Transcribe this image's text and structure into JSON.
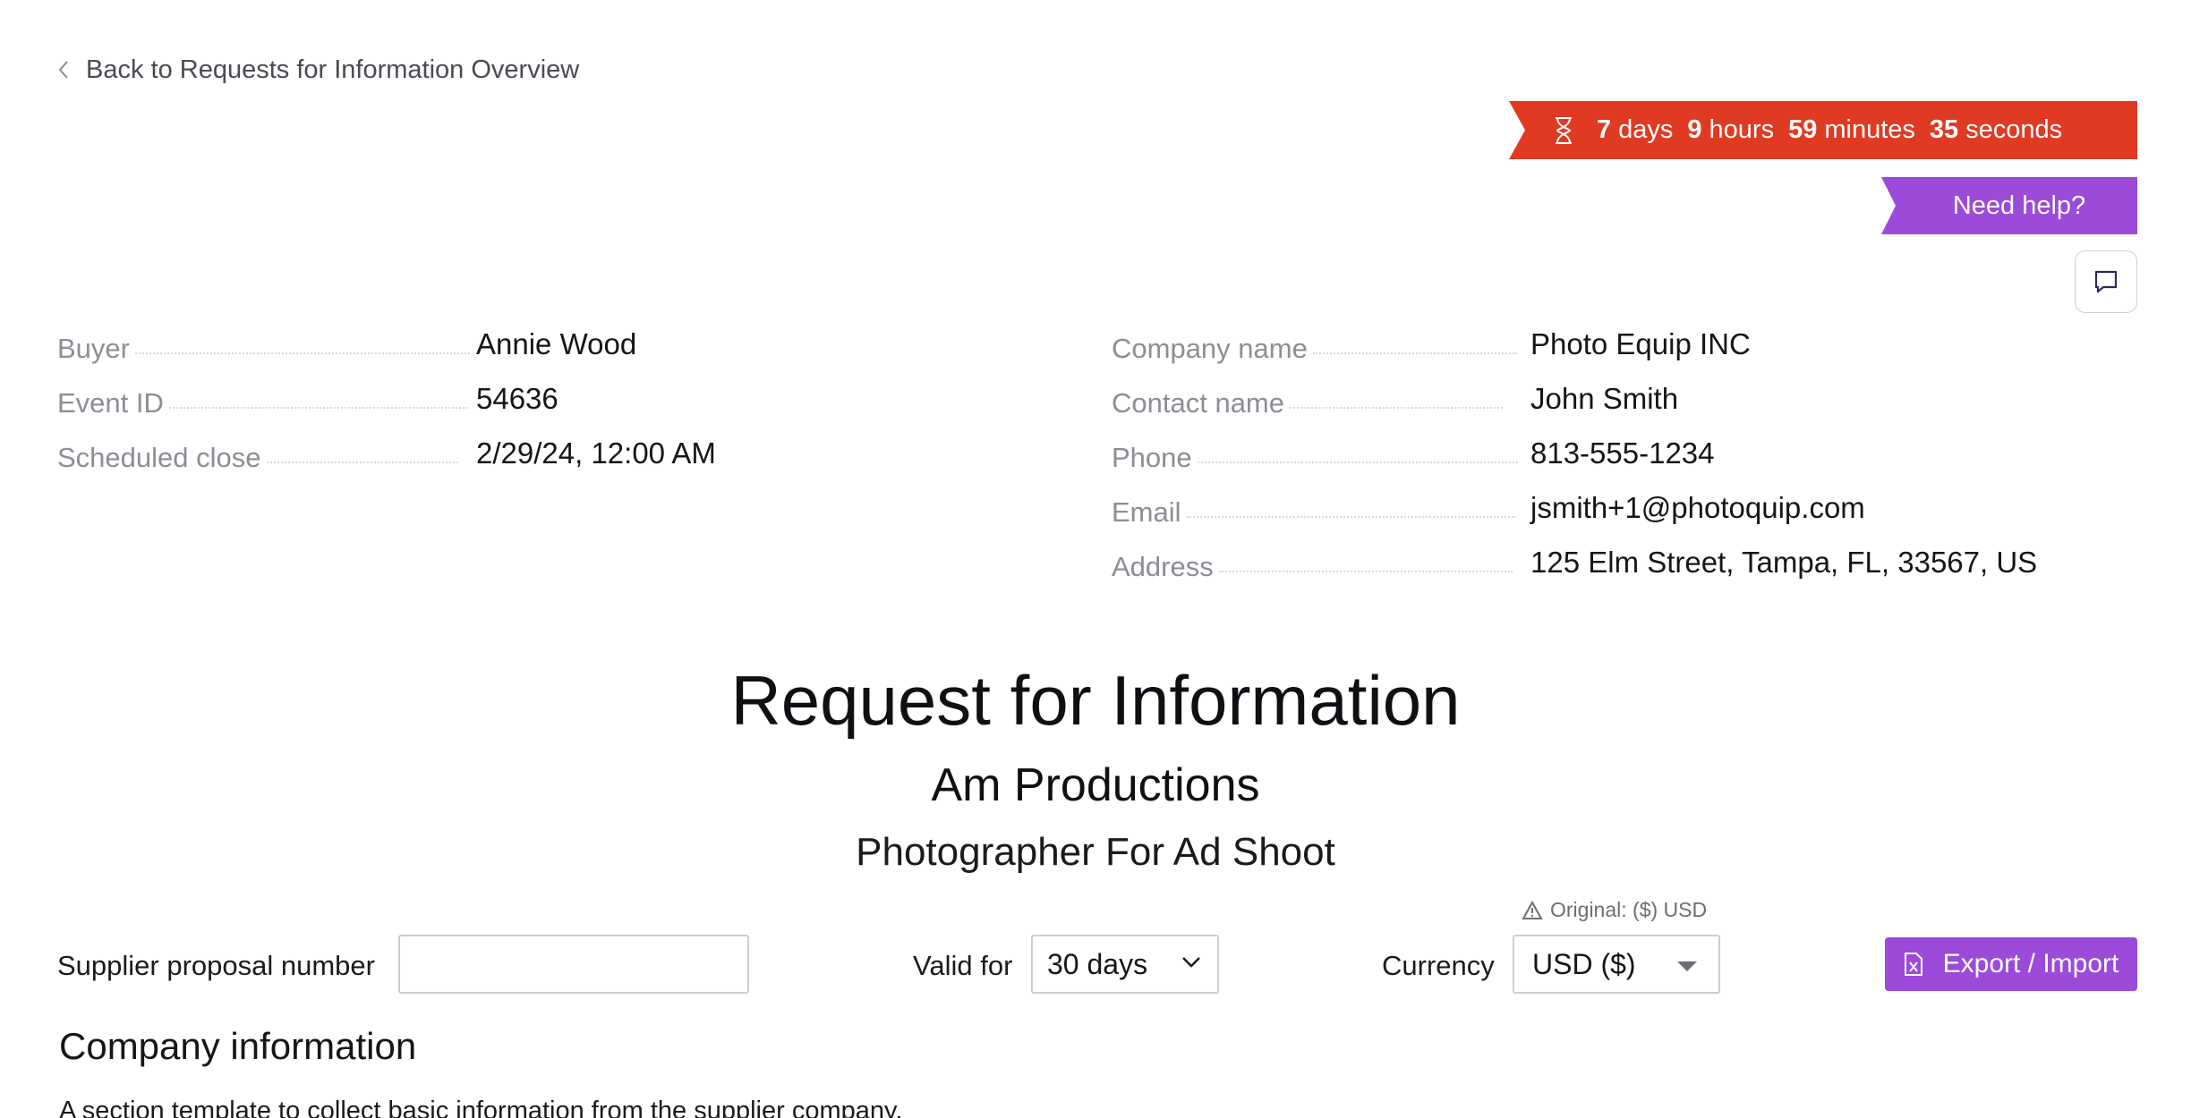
{
  "nav": {
    "back_label": "Back to Requests for Information Overview"
  },
  "timer": {
    "days": "7",
    "days_unit": "days",
    "hours": "9",
    "hours_unit": "hours",
    "minutes": "59",
    "minutes_unit": "minutes",
    "seconds": "35",
    "seconds_unit": "seconds",
    "color": "#e03a22"
  },
  "help": {
    "label": "Need help?",
    "color": "#9b4ad9"
  },
  "buyer_info": [
    {
      "label": "Buyer",
      "value": "Annie Wood"
    },
    {
      "label": "Event ID",
      "value": "54636"
    },
    {
      "label": "Scheduled close",
      "value": "2/29/24, 12:00 AM"
    }
  ],
  "supplier_info": [
    {
      "label": "Company name",
      "value": "Photo Equip INC"
    },
    {
      "label": "Contact name",
      "value": "John Smith"
    },
    {
      "label": "Phone",
      "value": "813-555-1234"
    },
    {
      "label": "Email",
      "value": "jsmith+1@photoquip.com"
    },
    {
      "label": "Address",
      "value": "125 Elm Street, Tampa, FL, 33567, US"
    }
  ],
  "header": {
    "title": "Request for Information",
    "company": "Am Productions",
    "event_name": "Photographer For Ad Shoot"
  },
  "form": {
    "proposal_label": "Supplier proposal number",
    "proposal_value": "",
    "valid_label": "Valid for",
    "valid_value": "30 days",
    "currency_label": "Currency",
    "currency_value": "USD ($)",
    "currency_note": "Original: ($) USD",
    "export_label": "Export / Import"
  },
  "section": {
    "title": "Company information",
    "description": "A section template to collect basic information from the supplier company."
  },
  "icons": {
    "back": "chevron-left-icon",
    "timer": "hourglass-icon",
    "chat": "chat-bubble-icon",
    "warning": "warning-triangle-icon",
    "export": "excel-file-icon"
  }
}
